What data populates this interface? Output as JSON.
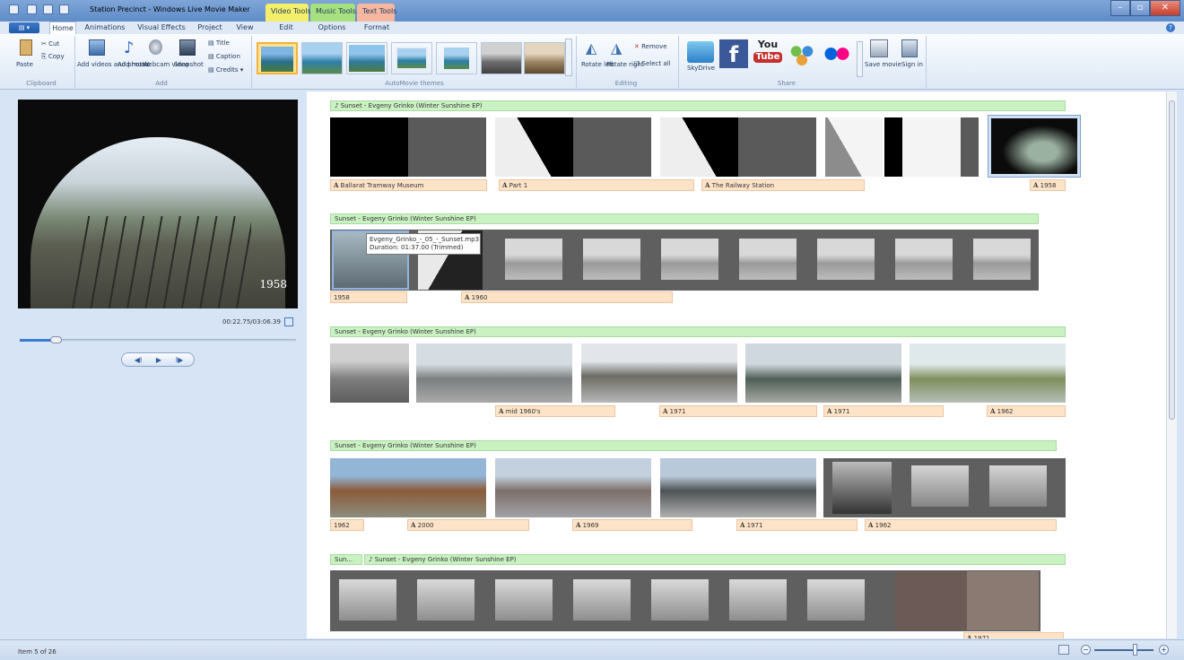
{
  "window": {
    "title": "Station Precinct - Windows Live Movie Maker",
    "min": "–",
    "max": "▫",
    "close": "✕"
  },
  "context_tabs": {
    "video": "Video Tools",
    "music": "Music Tools",
    "text": "Text Tools"
  },
  "tabs": [
    "Home",
    "Animations",
    "Visual Effects",
    "Project",
    "View",
    "Edit",
    "Options",
    "Format"
  ],
  "ribbon": {
    "clipboard": {
      "paste": "Paste",
      "cut": "Cut",
      "copy": "Copy",
      "group": "Clipboard"
    },
    "add": {
      "add_videos": "Add videos and photos",
      "add_music": "Add music",
      "webcam": "Webcam video",
      "snapshot": "Snapshot",
      "title": "Title",
      "caption": "Caption",
      "credits": "Credits",
      "group": "Add"
    },
    "themes_group": "AutoMovie themes",
    "editing": {
      "rotate_left": "Rotate left",
      "rotate_right": "Rotate right",
      "remove": "Remove",
      "select_all": "Select all",
      "group": "Editing"
    },
    "share": {
      "skydrive": "SkyDrive",
      "save_movie": "Save movie",
      "sign_in": "Sign in",
      "group": "Share",
      "facebook": "f",
      "youtube_top": "You",
      "youtube_bottom": "Tube"
    }
  },
  "preview": {
    "caption": "1958",
    "timecode": "00:22.75/03:06.39",
    "play": "▶",
    "prev": "◀I",
    "next": "I▶",
    "seek_fraction": 0.12
  },
  "tooltip": {
    "line1": "Evgeny_Grinko_-_05_-_Sunset.mp3",
    "line2": "Duration: 01:37.00 (Trimmed)"
  },
  "rows": [
    {
      "music": "♪ Sunset - Evgeny Grinko (Winter Sunshine EP)",
      "captions": [
        "Ballarat Tramway Museum",
        "Part 1",
        "The Railway Station",
        "1958"
      ]
    },
    {
      "music": "Sunset - Evgeny Grinko (Winter Sunshine EP)",
      "captions": [
        "1958",
        "1960"
      ]
    },
    {
      "music": "Sunset - Evgeny Grinko (Winter Sunshine EP)",
      "captions": [
        "mid 1960's",
        "1971",
        "1971",
        "1962"
      ]
    },
    {
      "music": "Sunset - Evgeny Grinko (Winter Sunshine EP)",
      "captions": [
        "1962",
        "2000",
        "1969",
        "1971",
        "1962"
      ]
    },
    {
      "music_a": "Sun...",
      "music_b": "♪ Sunset - Evgeny Grinko (Winter Sunshine EP)",
      "captions": [
        "1971"
      ]
    }
  ],
  "caption_letter": "A",
  "status": {
    "item": "Item 5 of 26",
    "zoom_out": "−",
    "zoom_in": "+"
  },
  "colors": {
    "music_bar": "#c9f1c2",
    "caption_bar": "#fde3c8",
    "strip": "#5f5f5f",
    "selected_theme": "#f2b23f"
  }
}
